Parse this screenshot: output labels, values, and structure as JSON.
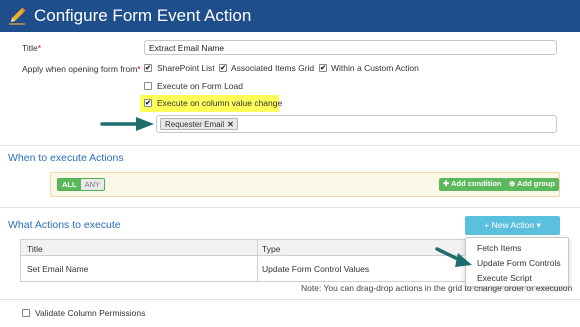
{
  "dialog": {
    "title": "Configure Form Event Action"
  },
  "form": {
    "title_label": "Title",
    "required_mark": "*",
    "title_value": "Extract Email Name",
    "apply_label": "Apply when opening form from",
    "apply_options": [
      {
        "label": "SharePoint List",
        "checked": true
      },
      {
        "label": "Associated Items Grid",
        "checked": true
      },
      {
        "label": "Within a Custom Action",
        "checked": true
      }
    ],
    "execute_on_load": {
      "label": "Execute on Form Load",
      "checked": false
    },
    "execute_on_change": {
      "label": "Execute on column value change",
      "checked": true
    },
    "columns_tag": "Requester Email",
    "tag_remove": "✕"
  },
  "when_section": {
    "heading": "When to execute Actions",
    "toggle_all": "ALL",
    "toggle_any": "ANY",
    "add_condition": "✚ Add condition",
    "add_group": "⊕ Add group"
  },
  "what_section": {
    "heading": "What Actions to execute",
    "new_action_button": "+ New Action ▾",
    "table": {
      "headers": [
        "Title",
        "Type"
      ],
      "rows": [
        {
          "title": "Set Email Name",
          "type": "Update Form Control Values"
        }
      ]
    },
    "note": "Note: You can drag-drop actions in the grid to change order of execution",
    "dropdown_items": [
      "Fetch Items",
      "Update Form Controls",
      "Execute Script"
    ]
  },
  "footer": {
    "validate_label": "Validate Column Permissions",
    "validate_checked": false
  },
  "colors": {
    "titlebar": "#1f4e8c",
    "highlight": "#ffff5a",
    "arrow": "#1f6e6e",
    "section_heading": "#2a6ebb",
    "green_button": "#5cb85c",
    "new_action_button": "#5bc0de"
  }
}
